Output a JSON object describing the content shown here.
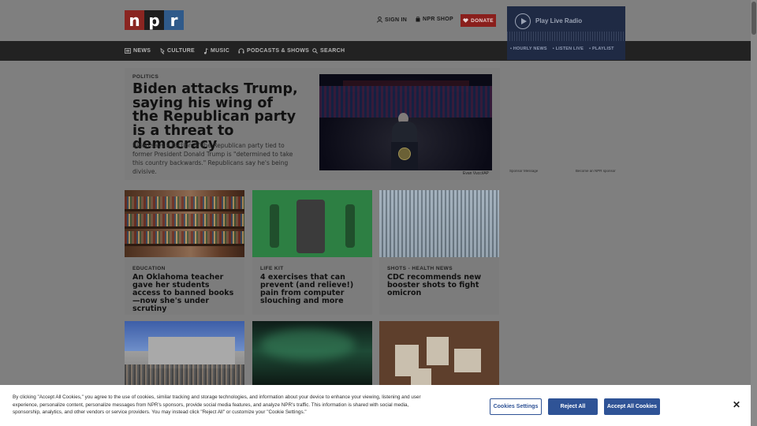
{
  "header": {
    "logo": {
      "letters": [
        "n",
        "p",
        "r"
      ]
    },
    "sign_in": "SIGN IN",
    "shop": "NPR SHOP",
    "donate": "DONATE"
  },
  "nav": {
    "items": [
      {
        "label": "NEWS",
        "icon": "news-icon"
      },
      {
        "label": "CULTURE",
        "icon": "culture-icon"
      },
      {
        "label": "MUSIC",
        "icon": "music-icon"
      },
      {
        "label": "PODCASTS & SHOWS",
        "icon": "headphones-icon"
      },
      {
        "label": "SEARCH",
        "icon": "search-icon"
      }
    ]
  },
  "player": {
    "label": "Play Live Radio",
    "links": [
      "HOURLY NEWS",
      "LISTEN LIVE",
      "PLAYLIST"
    ]
  },
  "hero": {
    "kicker": "POLITICS",
    "title": "Biden attacks Trump, saying his wing of the Republican party is a threat to democracy",
    "teaser": "Biden says a faction of the Republican party tied to former President Donald Trump is \"determined to take this country backwards.\" Republicans say he's being divisive.",
    "credit": "Evan Vucci/AP"
  },
  "sponsor": {
    "message": "Sponsor Message",
    "link": "Become an NPR sponsor"
  },
  "cards": [
    {
      "kicker": "EDUCATION",
      "title": "An Oklahoma teacher gave her students access to banned books—now she's under scrutiny"
    },
    {
      "kicker": "LIFE KIT",
      "title": "4 exercises that can prevent (and relieve!) pain from computer slouching and more"
    },
    {
      "kicker": "SHOTS - HEALTH NEWS",
      "title": "CDC recommends new booster shots to fight omicron"
    },
    {
      "kicker": "",
      "title": ""
    },
    {
      "kicker": "",
      "title": ""
    },
    {
      "kicker": "",
      "title": ""
    }
  ],
  "cookie": {
    "text": "By clicking \"Accept All Cookies,\" you agree to the use of cookies, similar tracking and storage technologies, and information about your device to enhance your viewing, listening and user experience, personalize content, personalize messages from NPR's sponsors, provide social media features, and analyze NPR's traffic. This information is shared with social media, sponsorship, analytics, and other vendors or service providers. You may instead click \"Reject All\" or customize your \"Cookie Settings.\"",
    "settings": "Cookies Settings",
    "reject": "Reject All",
    "accept": "Accept All Cookies",
    "close": "✕"
  },
  "colors": {
    "donate": "#8a1f1c",
    "player": "#1f2a44",
    "cookie_button": "#2f5396",
    "nav_bg": "#222222"
  }
}
